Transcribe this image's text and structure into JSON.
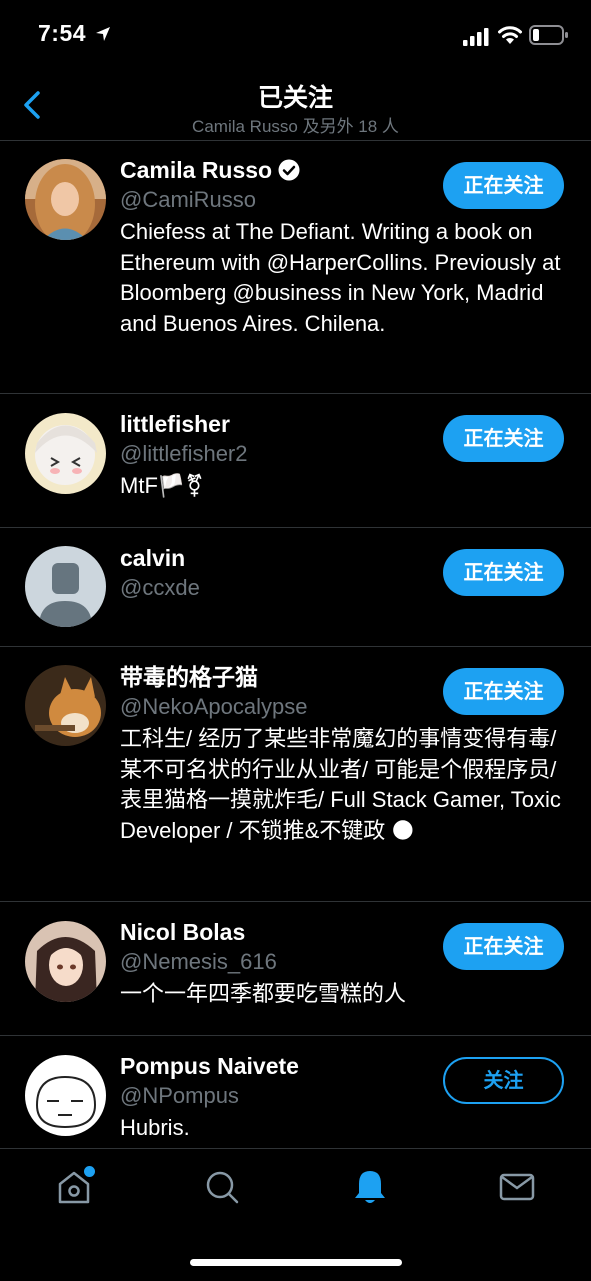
{
  "status_bar": {
    "time": "7:54"
  },
  "header": {
    "title": "已关注",
    "subtitle": "Camila Russo 及另外 18 人"
  },
  "users": [
    {
      "name": "Camila Russo",
      "verified": true,
      "handle": "@CamiRusso",
      "bio": "Chiefess at The Defiant. Writing a book on Ethereum with @HarperCollins. Previously at Bloomberg @business in New York, Madrid and Buenos Aires. Chilena.",
      "button": "正在关注"
    },
    {
      "name": "littlefisher",
      "verified": false,
      "handle": "@littlefisher2",
      "bio": "MtF🏳️⚧",
      "button": "正在关注"
    },
    {
      "name": "calvin",
      "verified": false,
      "handle": "@ccxde",
      "bio": "",
      "button": "正在关注"
    },
    {
      "name": "带毒的格子猫",
      "verified": false,
      "handle": "@NekoApocalypse",
      "bio": "工科生/ 经历了某些非常魔幻的事情变得有毒/ 某不可名状的行业从业者/ 可能是个假程序员/ 表里猫格一摸就炸毛/ Full Stack Gamer, Toxic Developer / 不锁推&不键政 🌑",
      "button": "正在关注"
    },
    {
      "name": "Nicol Bolas",
      "verified": false,
      "handle": "@Nemesis_616",
      "bio": "一个一年四季都要吃雪糕的人",
      "button": "正在关注"
    },
    {
      "name": "Pompus Naivete",
      "verified": false,
      "handle": "@NPompus",
      "bio": "Hubris.",
      "button": "关注"
    }
  ],
  "tabbar": {
    "icons": [
      "home-icon",
      "search-icon",
      "notifications-icon",
      "messages-icon"
    ],
    "active": "notifications-icon"
  },
  "colors": {
    "accent": "#1da1f2",
    "background": "#000000",
    "secondary_text": "#6e767d",
    "divider": "#2f3336"
  }
}
